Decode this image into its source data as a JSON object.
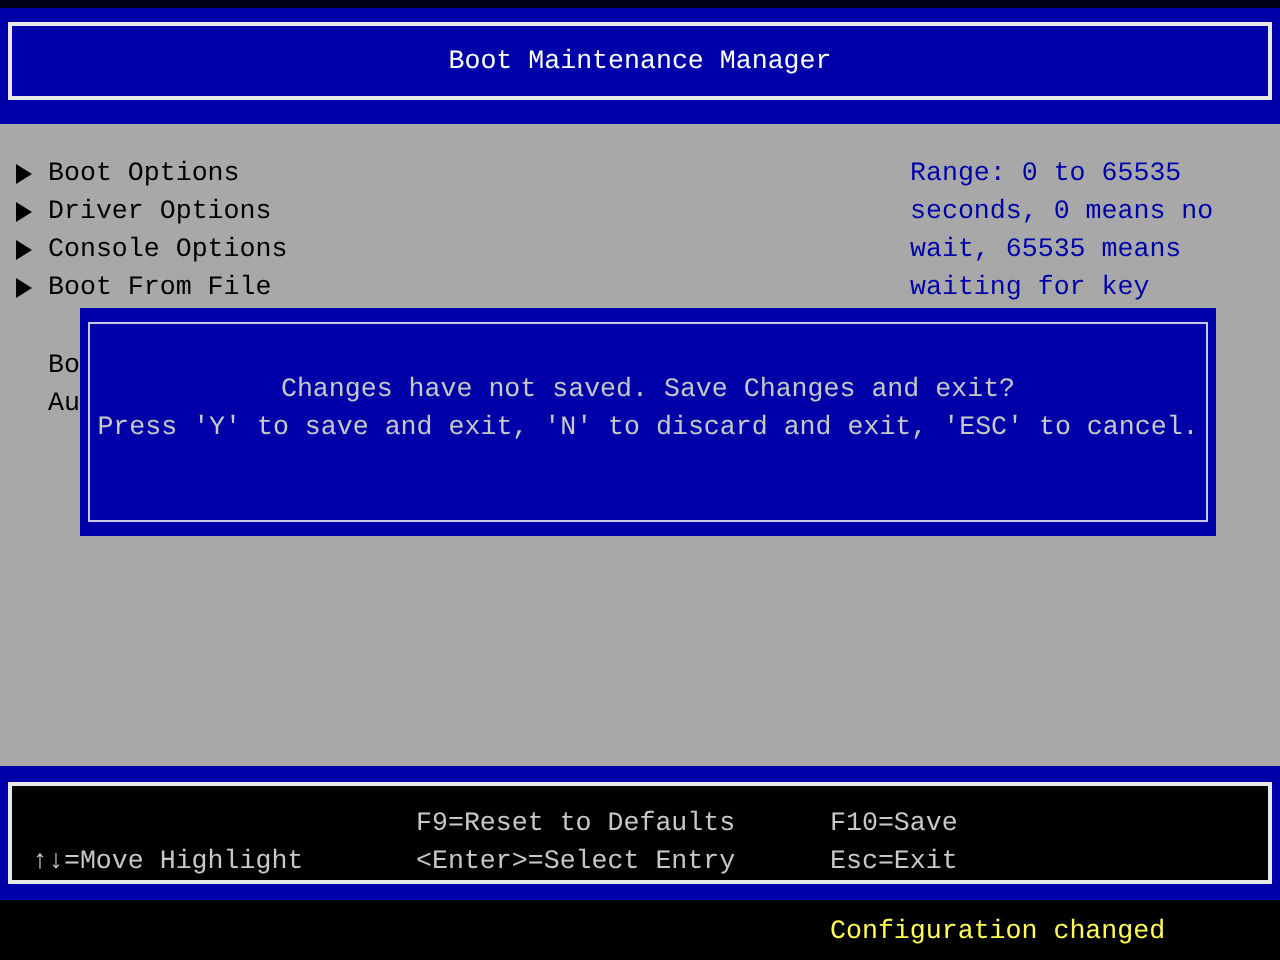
{
  "header": {
    "title": "Boot Maintenance Manager"
  },
  "menu": [
    {
      "label": "Boot Options"
    },
    {
      "label": "Driver Options"
    },
    {
      "label": "Console Options"
    },
    {
      "label": "Boot From File"
    }
  ],
  "settings": [
    "Bo",
    "Au"
  ],
  "help_text": [
    "Range: 0 to 65535",
    "seconds, 0 means no",
    "wait, 65535 means",
    "waiting for key"
  ],
  "dialog": {
    "lines": [
      "Changes have not saved. Save Changes and exit?",
      "Press 'Y' to save and exit, 'N' to discard and exit, 'ESC' to cancel."
    ]
  },
  "footer": {
    "columns": [
      [
        "",
        "↑↓=Move Highlight"
      ],
      [
        "F9=Reset to Defaults",
        "<Enter>=Select Entry"
      ],
      [
        "F10=Save",
        "Esc=Exit"
      ]
    ]
  },
  "status_bar": "Configuration changed"
}
